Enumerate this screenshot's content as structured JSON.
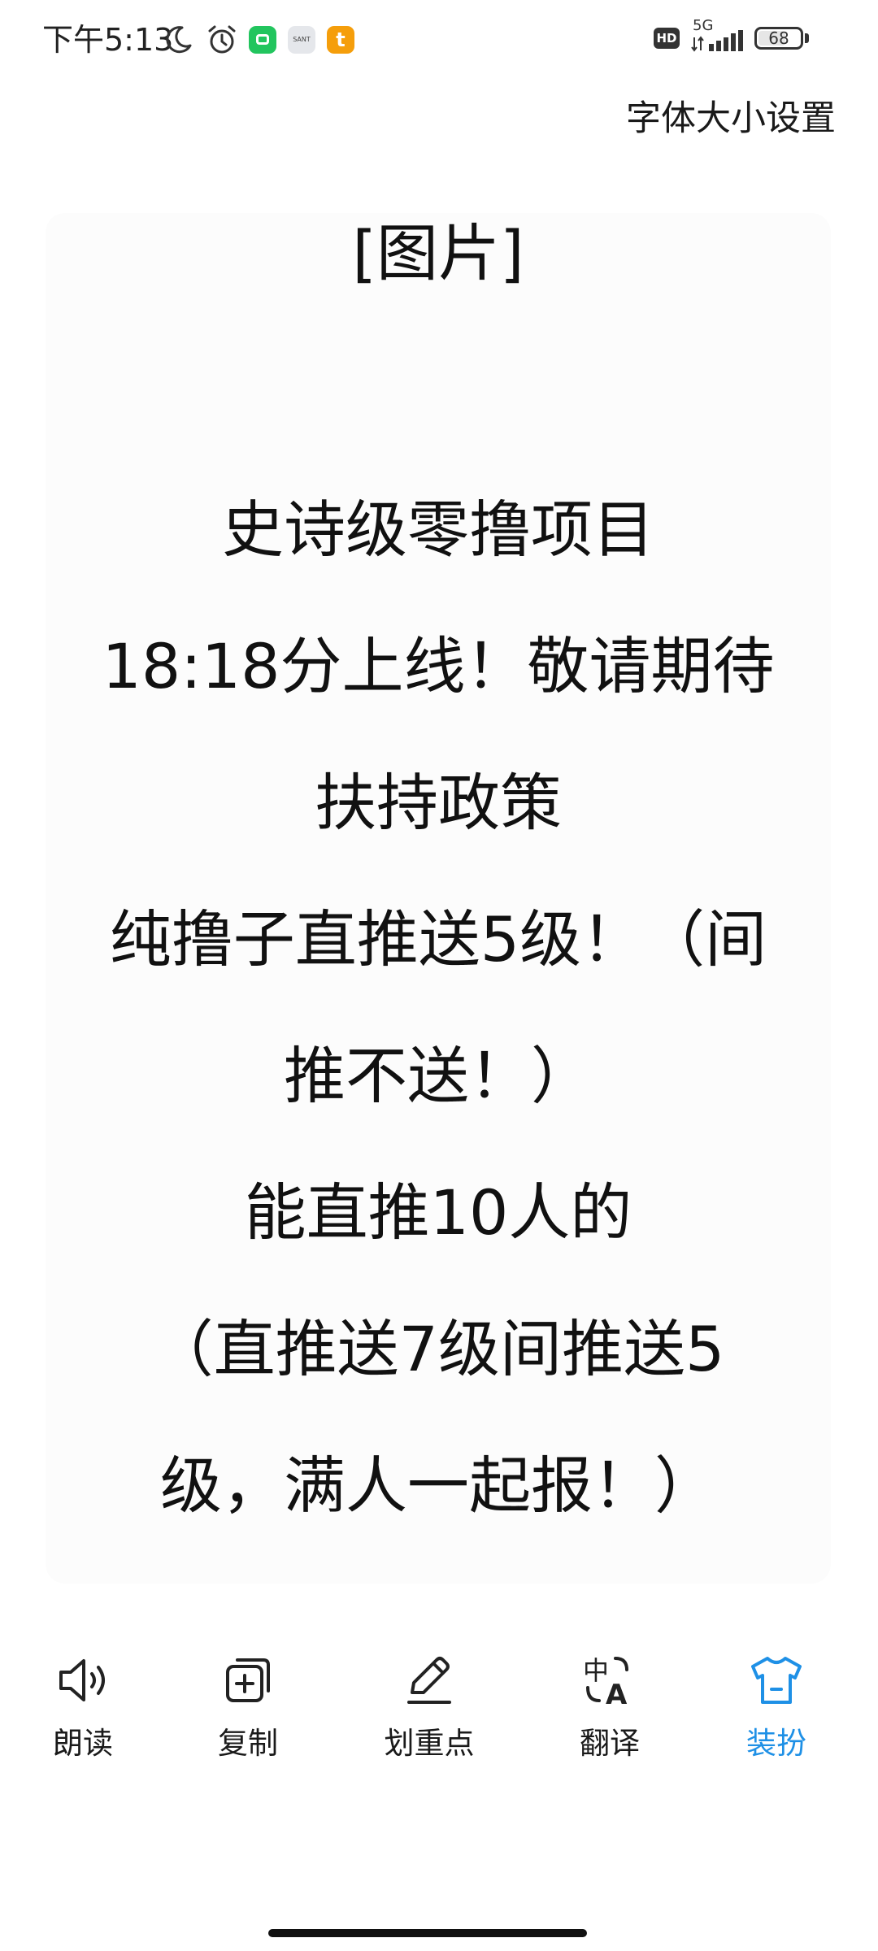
{
  "status_bar": {
    "time": "下午5:13",
    "network": "5G",
    "hd": "HD",
    "battery": "68",
    "battery_level": 0.68,
    "app_icon_gray_text": "SANT",
    "app_icon_orange_text": "t"
  },
  "header": {
    "font_size_setting": "字体大小设置"
  },
  "content": {
    "lines": [
      "[图片]",
      "史诗级零撸项目",
      "18:18分上线！敬请期待",
      "扶持政策",
      "纯撸子直推送5级！（间",
      "推不送！）",
      "能直推10人的",
      "（直推送7级间推送5",
      "级，满人一起报！）"
    ]
  },
  "toolbar": {
    "items": [
      {
        "label": "朗读",
        "icon": "speaker-icon"
      },
      {
        "label": "复制",
        "icon": "copy-icon"
      },
      {
        "label": "划重点",
        "icon": "pen-icon"
      },
      {
        "label": "翻译",
        "icon": "translate-icon"
      },
      {
        "label": "装扮",
        "icon": "shirt-icon",
        "active": true
      }
    ]
  },
  "colors": {
    "accent": "#1e90e6",
    "text": "#1a1a1a",
    "card_background": "#fcfcfc"
  }
}
